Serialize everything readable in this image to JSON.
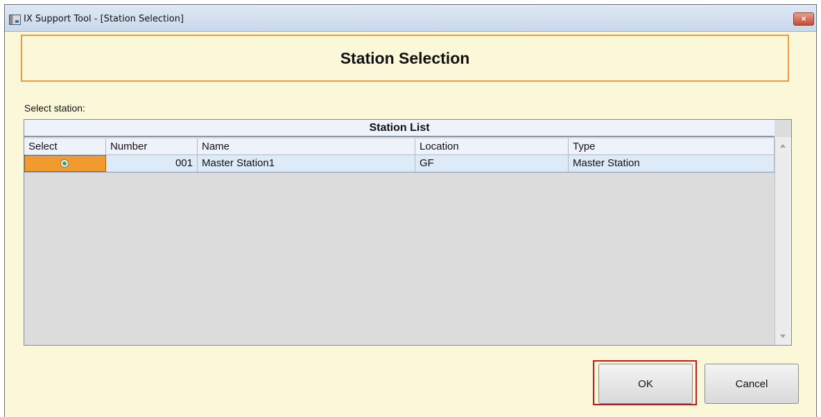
{
  "window": {
    "title": "IX Support Tool - [Station Selection]",
    "close_label": "×"
  },
  "header": {
    "title": "Station Selection"
  },
  "prompt": "Select station:",
  "station_list": {
    "title": "Station List",
    "columns": [
      "Select",
      "Number",
      "Name",
      "Location",
      "Type"
    ],
    "rows": [
      {
        "selected": true,
        "number": "001",
        "name": "Master Station1",
        "location": "GF",
        "type": "Master Station"
      }
    ]
  },
  "buttons": {
    "ok": "OK",
    "cancel": "Cancel"
  },
  "colors": {
    "accent_orange": "#f0983c",
    "highlight_red": "#d0141a",
    "background": "#fbf7d9"
  }
}
